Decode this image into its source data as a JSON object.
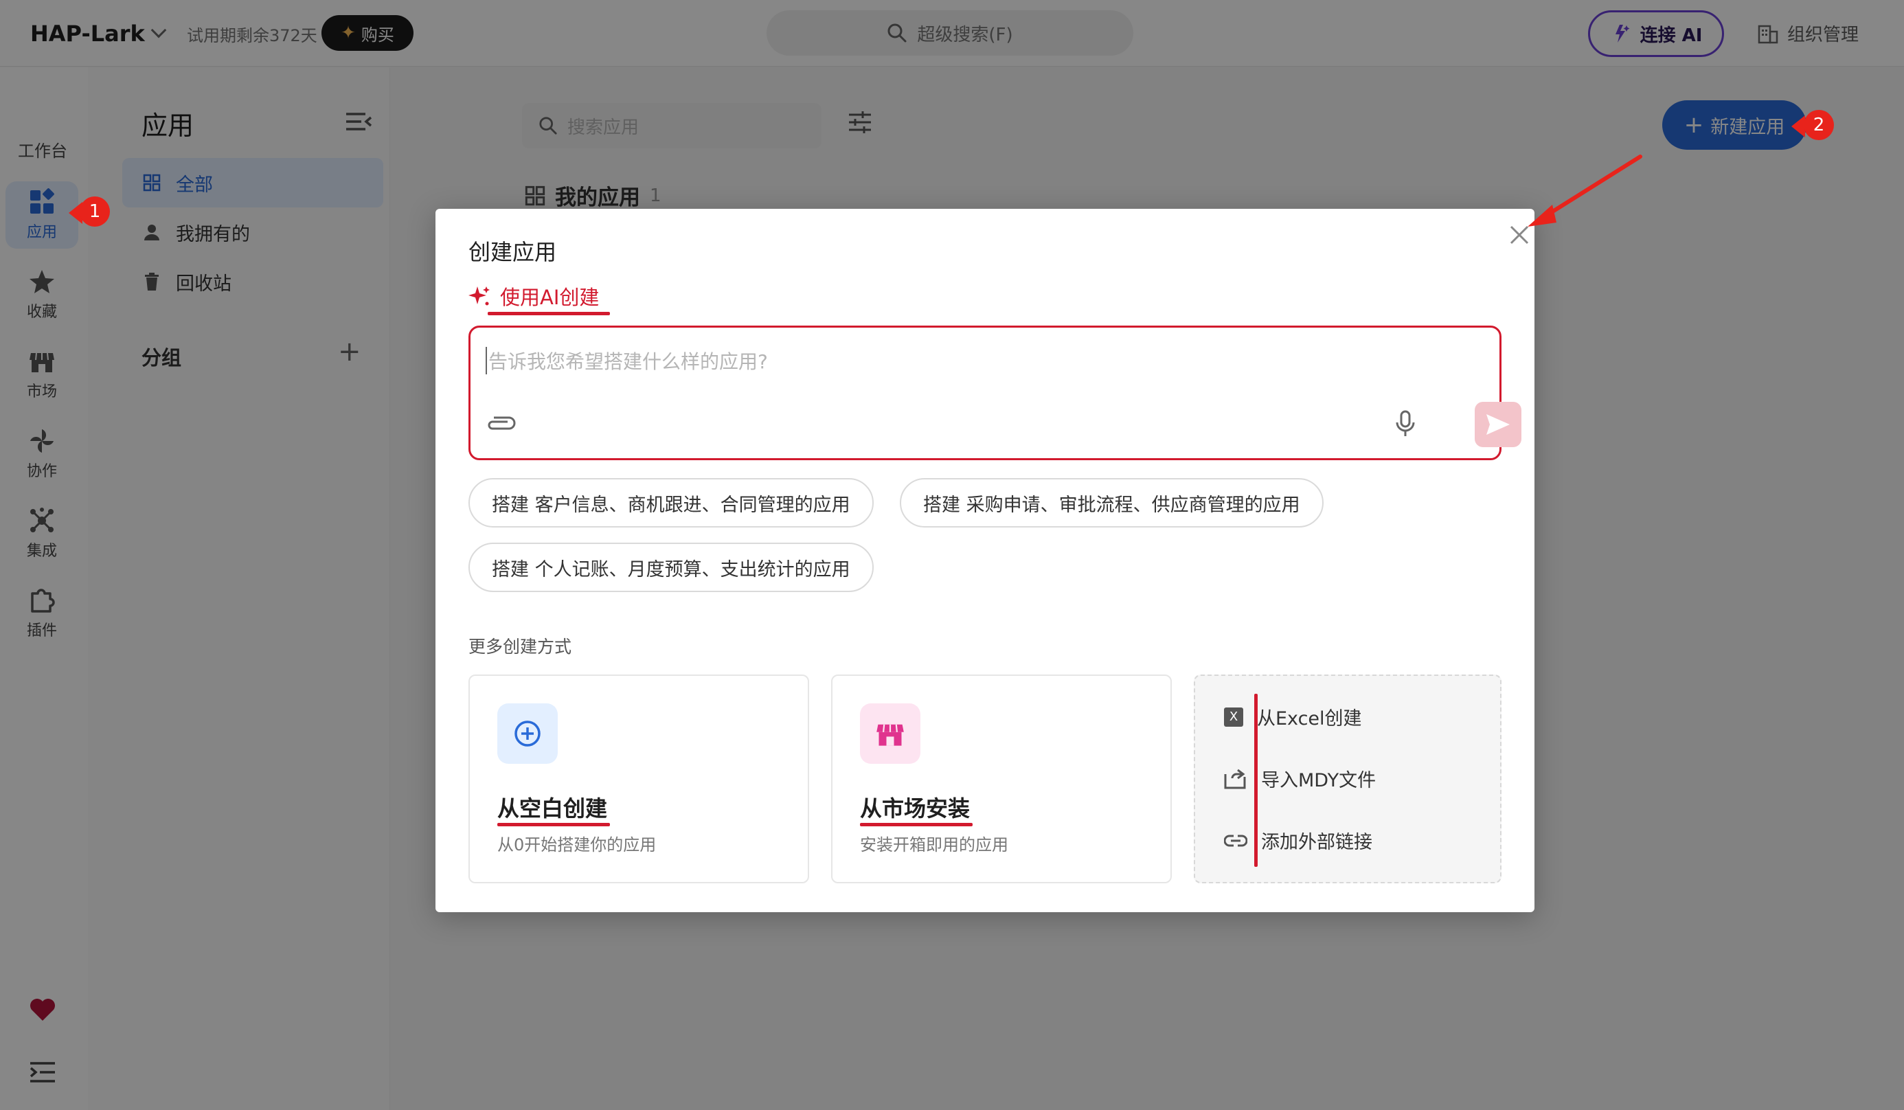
{
  "header": {
    "app_name": "HAP-Lark",
    "trial_text": "试用期剩余372天",
    "buy_label": "购买",
    "search_placeholder": "超级搜索(F)",
    "connect_ai_label": "连接 AI",
    "org_label": "组织管理"
  },
  "rail": {
    "workspace_label": "工作台",
    "items": [
      {
        "label": "应用",
        "icon": "apps-icon",
        "active": true
      },
      {
        "label": "收藏",
        "icon": "star-icon"
      },
      {
        "label": "市场",
        "icon": "store-icon"
      },
      {
        "label": "协作",
        "icon": "pinwheel-icon"
      },
      {
        "label": "集成",
        "icon": "hub-icon"
      },
      {
        "label": "插件",
        "icon": "puzzle-icon"
      }
    ]
  },
  "panel": {
    "title": "应用",
    "nav": [
      {
        "label": "全部",
        "icon": "grid-icon",
        "active": true
      },
      {
        "label": "我拥有的",
        "icon": "person-icon"
      },
      {
        "label": "回收站",
        "icon": "trash-icon"
      }
    ],
    "group_title": "分组"
  },
  "main": {
    "search_placeholder": "搜索应用",
    "section_title": "我的应用",
    "section_count": "1",
    "new_app_label": "新建应用"
  },
  "modal": {
    "title": "创建应用",
    "ai_tab_label": "使用AI创建",
    "prompt_placeholder": "告诉我您希望搭建什么样的应用?",
    "suggestions": [
      "搭建 客户信息、商机跟进、合同管理的应用",
      "搭建 采购申请、审批流程、供应商管理的应用",
      "搭建 个人记账、月度预算、支出统计的应用"
    ],
    "more_title": "更多创建方式",
    "cards": [
      {
        "title": "从空白创建",
        "desc": "从0开始搭建你的应用",
        "icon": "plus-circle-icon"
      },
      {
        "title": "从市场安装",
        "desc": "安装开箱即用的应用",
        "icon": "store-icon"
      }
    ],
    "options": [
      {
        "label": "从Excel创建",
        "icon": "excel-icon"
      },
      {
        "label": "导入MDY文件",
        "icon": "import-icon"
      },
      {
        "label": "添加外部链接",
        "icon": "link-icon"
      }
    ]
  },
  "annotations": {
    "badge_1": "1",
    "badge_2": "2"
  },
  "colors": {
    "primary_blue": "#2a6bd8",
    "ai_red": "#d21a2e",
    "ai_purple": "#6b40d6",
    "annotation_red": "#e8231b"
  }
}
